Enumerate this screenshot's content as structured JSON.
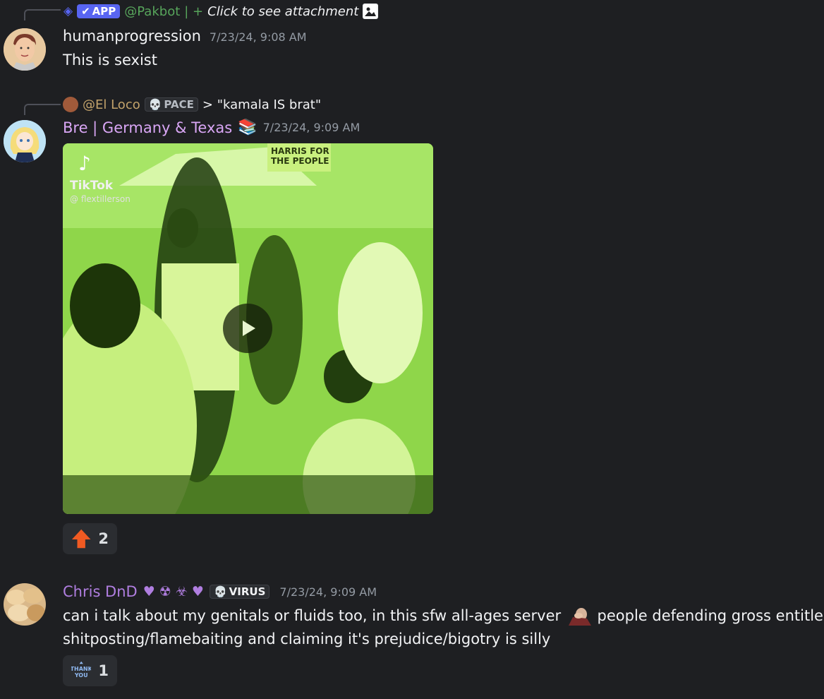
{
  "messages": [
    {
      "reply": {
        "badge": "APP",
        "mention": "@Pakbot",
        "separator": "| +",
        "text": "Click to see attachment"
      },
      "author": "humanprogression",
      "timestamp": "7/23/24, 9:08 AM",
      "text": "This is sexist"
    },
    {
      "reply": {
        "mention": "@El Loco",
        "role_badge": "PACE",
        "text": "> \"kamala IS brat\""
      },
      "author": "Bre | Germany & Texas",
      "timestamp": "7/23/24, 9:09 AM",
      "video": {
        "watermark_brand": "TikTok",
        "watermark_handle": "@ flextillerson",
        "sign_text": "HARRIS FOR THE PEOPLE"
      },
      "reactions": [
        {
          "icon": "up-arrow-emoji",
          "count": "2"
        }
      ]
    },
    {
      "author": "Chris DnD",
      "author_suffix": "♥ ☢ ☣ ♥",
      "role_badge": "VIRUS",
      "timestamp": "7/23/24, 9:09 AM",
      "text_part1": "can i talk about my genitals or fluids too, in this sfw all-ages server",
      "text_part2": "people defending gross entitled",
      "text_line2": "shitposting/flamebaiting and claiming it's prejudice/bigotry is silly",
      "reactions": [
        {
          "icon": "thank-you-emoji",
          "label": "THANK YOU",
          "count": "1"
        }
      ]
    }
  ],
  "colors": {
    "background": "#1e1f22",
    "app_badge": "#5865f2",
    "pakbot_mention": "#57a45b",
    "el_loco_name": "#c3a36b",
    "bre_name": "#d9a6f5",
    "chris_name": "#b07ee0",
    "arrow_emoji": "#f05a22"
  }
}
